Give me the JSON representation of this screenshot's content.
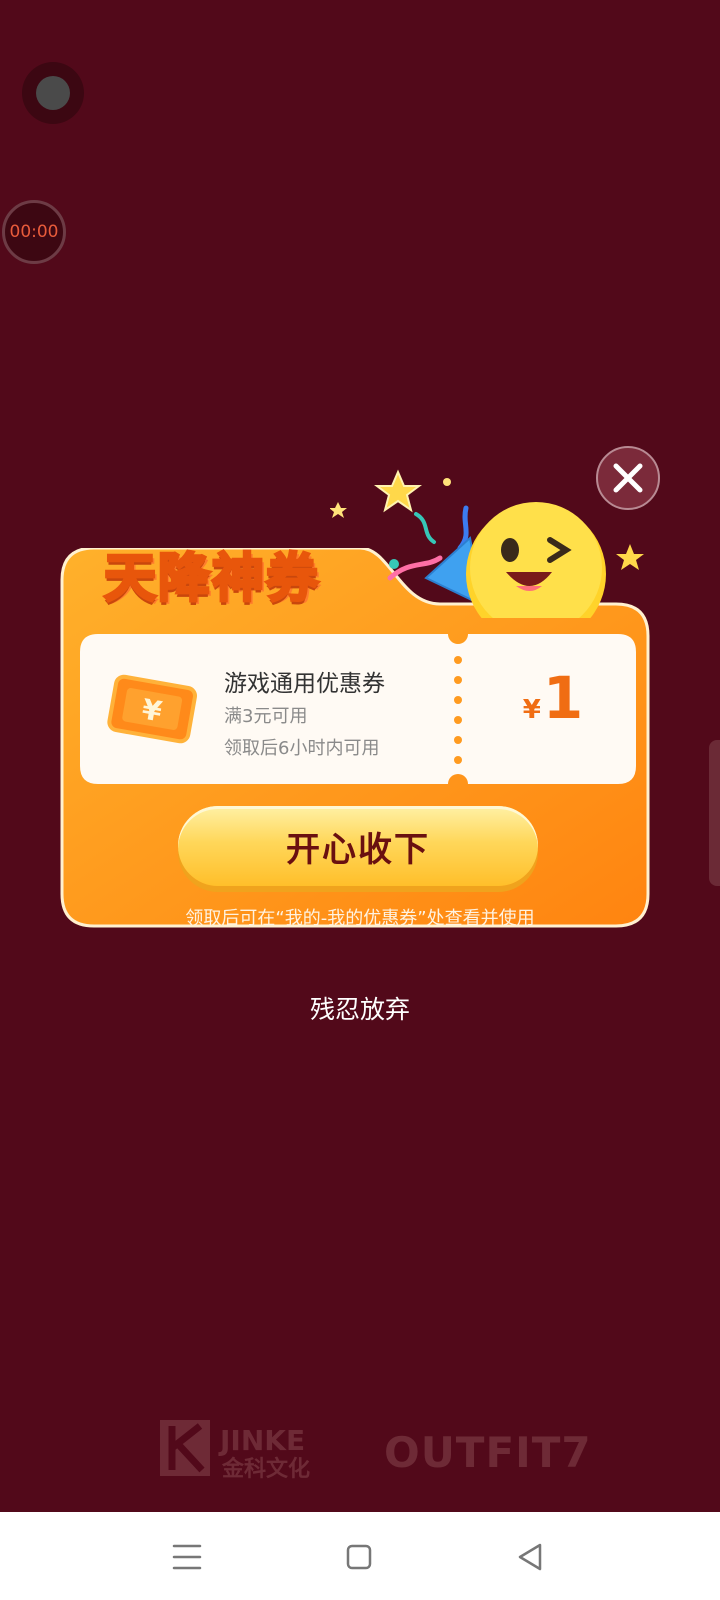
{
  "overlay": {
    "timer_text": "00:00"
  },
  "popup": {
    "title": "天降神券",
    "coupon": {
      "name": "游戏通用优惠券",
      "condition": "满3元可用",
      "validity": "领取后6小时内可用",
      "currency_symbol": "¥",
      "amount": "1",
      "icon": "yen-ticket-icon"
    },
    "accept_label": "开心收下",
    "hint": "领取后可在“我的-我的优惠券”处查看并使用",
    "close_icon": "close-icon"
  },
  "dismiss_label": "残忍放弃",
  "brands": {
    "jinke_en": "JINKE",
    "jinke_cn": "金科文化",
    "outfit": "OUTFIT7"
  },
  "navbar": {
    "menu_icon": "menu-icon",
    "home_icon": "home-square-icon",
    "back_icon": "back-triangle-icon"
  },
  "colors": {
    "background": "#52091a",
    "card_orange": "#ff9a1f",
    "amount_orange": "#f06d13",
    "button_yellow": "#ffd75a",
    "button_text": "#6a1010"
  }
}
